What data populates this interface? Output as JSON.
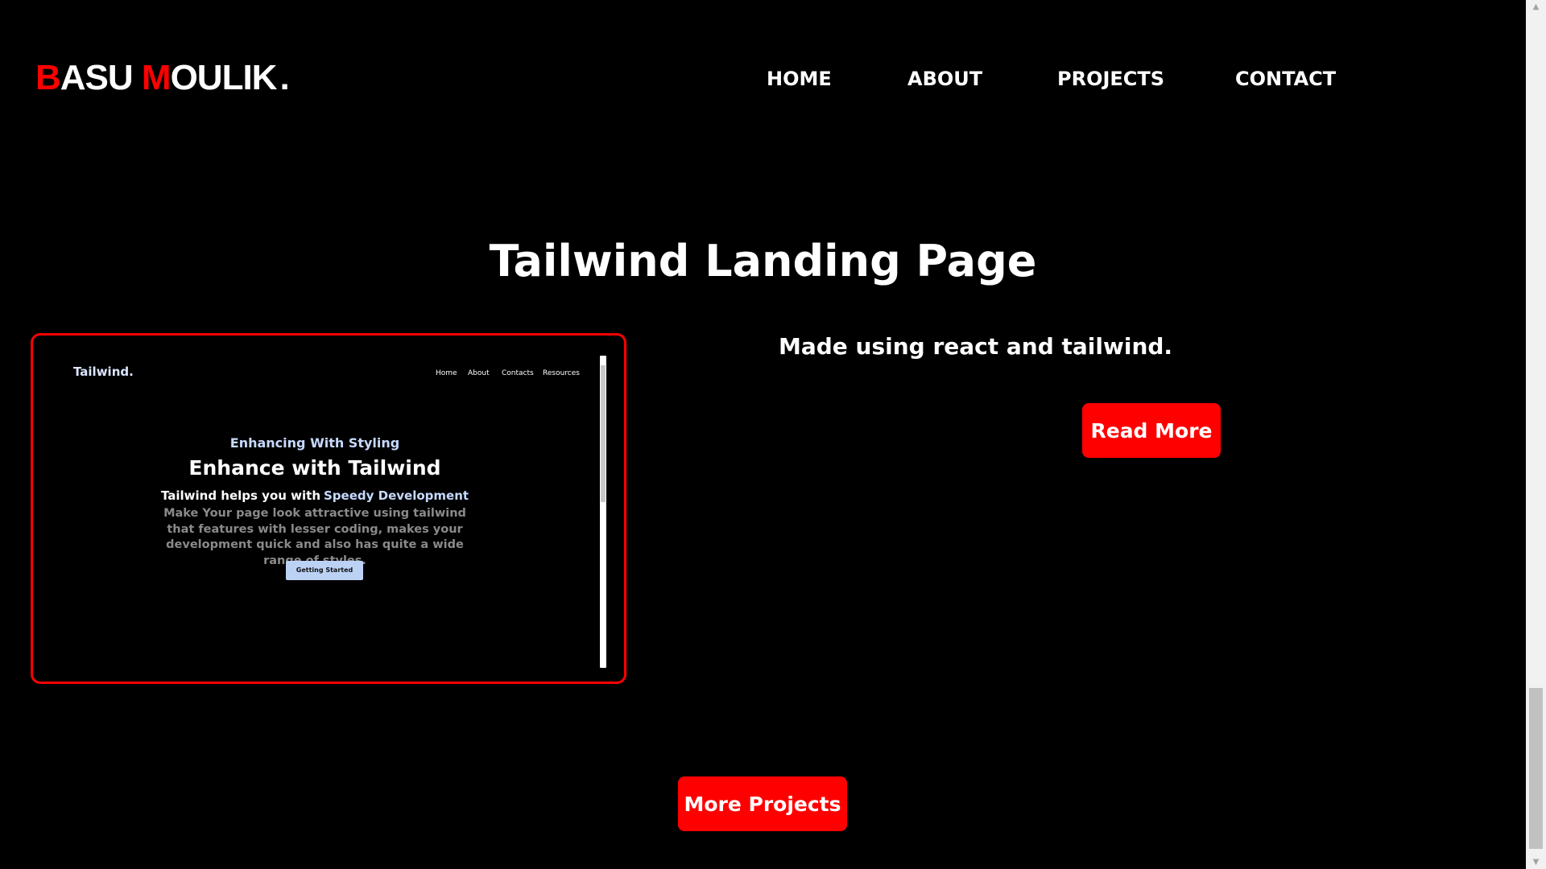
{
  "header": {
    "logo": {
      "first_initial": "B",
      "first_rest": "ASU ",
      "last_initial": "M",
      "last_rest": "OULIK",
      "dot": "."
    },
    "nav": [
      {
        "label": "HOME"
      },
      {
        "label": "ABOUT"
      },
      {
        "label": "PROJECTS"
      },
      {
        "label": "CONTACT"
      }
    ]
  },
  "project": {
    "title": "Tailwind Landing Page",
    "description": "Made using react and tailwind.",
    "read_more_label": "Read More",
    "preview": {
      "brand": "Tailwind.",
      "nav": [
        "Home",
        "About",
        "Contacts",
        "Resources"
      ],
      "tagline": "Enhancing With Styling",
      "heading": "Enhance with Tailwind",
      "sub_prefix": "Tailwind helps you with",
      "sub_highlight": "Speedy Development",
      "description": "Make Your page look attractive using tailwind that features with lesser coding, makes your development quick and also has quite a wide range of styles.",
      "button_label": "Getting Started"
    }
  },
  "more_projects_label": "More Projects",
  "colors": {
    "accent": "#ff0000",
    "background": "#000000",
    "text": "#ffffff"
  },
  "icons": {
    "scroll_up": "triangle-up-icon",
    "scroll_down": "triangle-down-icon"
  }
}
